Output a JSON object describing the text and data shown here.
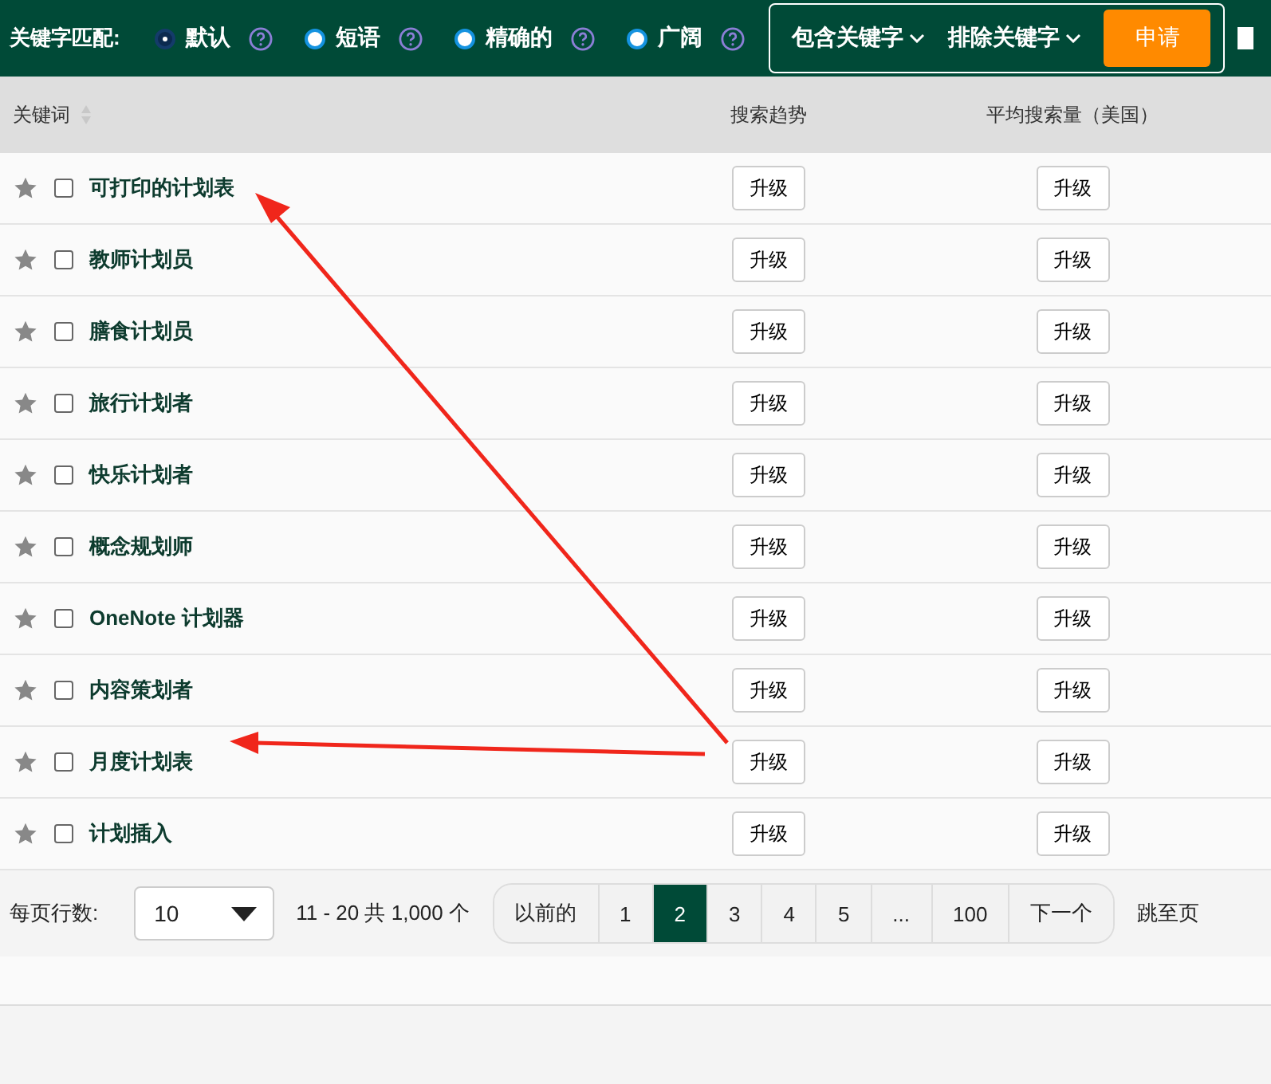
{
  "match_bar": {
    "label": "关键字匹配:",
    "options": [
      {
        "label": "默认",
        "selected": true
      },
      {
        "label": "短语",
        "selected": false
      },
      {
        "label": "精确的",
        "selected": false
      },
      {
        "label": "广阔",
        "selected": false
      }
    ],
    "include_dropdown": "包含关键字",
    "exclude_dropdown": "排除关键字",
    "apply_button": "申请"
  },
  "table": {
    "columns": [
      "关键词",
      "搜索趋势",
      "平均搜索量（美国）"
    ],
    "rows": [
      {
        "keyword": "可打印的计划表",
        "checked": false,
        "trend": "升级",
        "volume": "升级"
      },
      {
        "keyword": "教师计划员",
        "checked": false,
        "trend": "升级",
        "volume": "升级"
      },
      {
        "keyword": "膳食计划员",
        "checked": false,
        "trend": "升级",
        "volume": "升级"
      },
      {
        "keyword": "旅行计划者",
        "checked": false,
        "trend": "升级",
        "volume": "升级"
      },
      {
        "keyword": "快乐计划者",
        "checked": false,
        "trend": "升级",
        "volume": "升级"
      },
      {
        "keyword": "概念规划师",
        "checked": false,
        "trend": "升级",
        "volume": "升级"
      },
      {
        "keyword": "OneNote 计划器",
        "checked": false,
        "trend": "升级",
        "volume": "升级"
      },
      {
        "keyword": "内容策划者",
        "checked": false,
        "trend": "升级",
        "volume": "升级"
      },
      {
        "keyword": "月度计划表",
        "checked": false,
        "trend": "升级",
        "volume": "升级"
      },
      {
        "keyword": "计划插入",
        "checked": false,
        "trend": "升级",
        "volume": "升级"
      }
    ]
  },
  "pagination": {
    "rows_label": "每页行数:",
    "rows_value": "10",
    "range": "11 - 20 共 1,000 个",
    "pages": [
      {
        "label": "以前的",
        "selected": false
      },
      {
        "label": "1",
        "selected": false
      },
      {
        "label": "2",
        "selected": true
      },
      {
        "label": "3",
        "selected": false
      },
      {
        "label": "4",
        "selected": false
      },
      {
        "label": "5",
        "selected": false
      },
      {
        "label": "...",
        "selected": false
      },
      {
        "label": "100",
        "selected": false
      },
      {
        "label": "下一个",
        "selected": false
      }
    ],
    "jump_label": "跳至页"
  }
}
